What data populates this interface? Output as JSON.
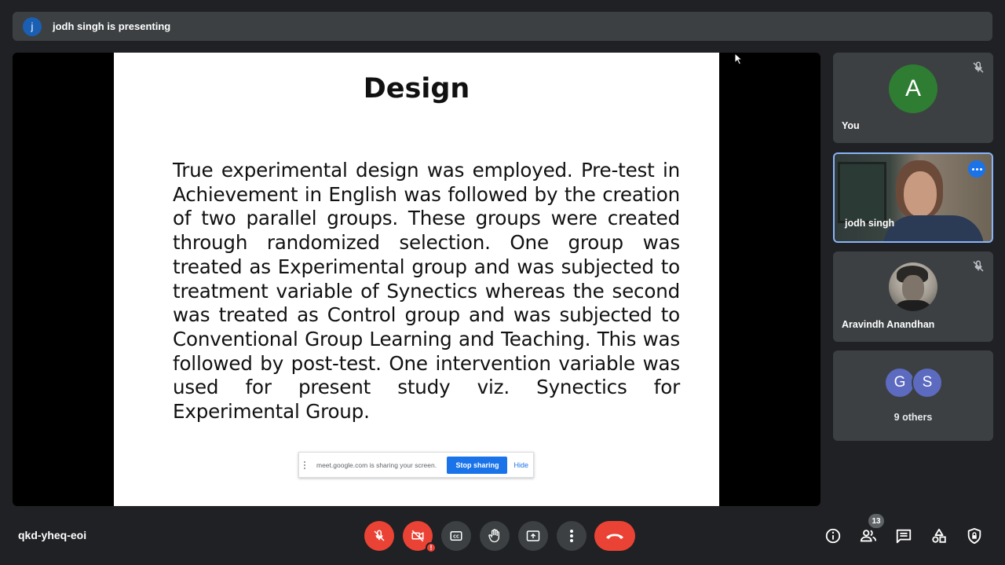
{
  "presenting_bar": {
    "avatar_letter": "j",
    "text": "jodh singh is presenting"
  },
  "slide": {
    "title": "Design",
    "body": "True experimental design was employed. Pre-test in Achievement in English was followed by the creation of two parallel groups. These groups were created through randomized selection. One group was treated as Experimental group and was subjected to treatment variable of Synectics whereas the second was treated as Control group and was subjected to Conventional Group Learning and Teaching. This was followed by post-test. One intervention variable was used for present study viz. Synectics for Experimental Group."
  },
  "share_notice": {
    "text": "meet.google.com is sharing your screen.",
    "stop_label": "Stop sharing",
    "hide_label": "Hide"
  },
  "participants": [
    {
      "name": "You",
      "avatar_letter": "A",
      "mic": "mic-off-icon"
    },
    {
      "name": "jodh singh",
      "state": "presenting-video"
    },
    {
      "name": "Aravindh Anandhan",
      "mic": "mic-off-icon"
    },
    {
      "avatars": [
        "G",
        "S"
      ],
      "label": "9 others"
    }
  ],
  "bottom_bar": {
    "meeting_code": "qkd-yheq-eoi",
    "warning_badge": "!",
    "participant_count": "13"
  },
  "colors": {
    "accent": "#1a73e8",
    "danger": "#ea4335",
    "surface": "#3c4043",
    "background": "#202124"
  }
}
